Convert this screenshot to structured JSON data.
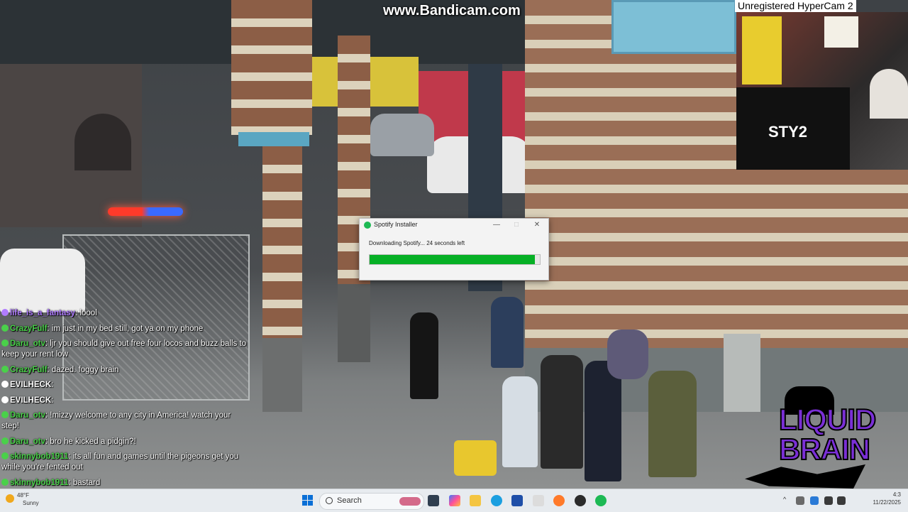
{
  "stream": {
    "bandicam_watermark": "www.Bandicam.com",
    "hypercam_watermark": "Unregistered HyperCam 2",
    "webcam_logo_text": "STY2",
    "overlay_brand": {
      "line1": "LIQUID",
      "line2": "BRAIN"
    }
  },
  "installer": {
    "title": "Spotify Installer",
    "status": "Downloading Spotify... 24 seconds left",
    "progress": 0.97,
    "buttons": {
      "minimize": "—",
      "maximize": "□",
      "close": "✕"
    },
    "icon": "spotify-icon",
    "accent": "#06b025"
  },
  "chat": [
    {
      "user": "life_is_a_fantasy",
      "text": "loool",
      "color": "#b07cff"
    },
    {
      "user": "CrazyFulf",
      "text": "im just in my bed still, got ya on my phone",
      "color": "#4ad04a"
    },
    {
      "user": "Daru_otv",
      "text": "ljr you should give out free four locos and buzz balls to keep your rent low",
      "color": "#4ad04a"
    },
    {
      "user": "CrazyFulf",
      "text": "dazed. foggy brain",
      "color": "#4ad04a"
    },
    {
      "user": "EVILHECK",
      "text": "",
      "color": "#ffffff"
    },
    {
      "user": "EVILHECK",
      "text": "",
      "color": "#ffffff"
    },
    {
      "user": "Daru_otv",
      "text": "!mizzy welcome to any city in America! watch your step!",
      "color": "#4ad04a"
    },
    {
      "user": "Daru_otv",
      "text": "bro he kicked a pidgin?!",
      "color": "#4ad04a"
    },
    {
      "user": "skinnybob1911",
      "text": "its all fun and games until the pigeons get you while you're fented out",
      "color": "#4ad04a"
    },
    {
      "user": "skinnybob1911",
      "text": "bastard",
      "color": "#4ad04a"
    }
  ],
  "taskbar": {
    "weather_temp": "48°F",
    "weather_text": "Sunny",
    "search_placeholder": "Search",
    "date": "11/22/2025",
    "time": "4:3"
  }
}
